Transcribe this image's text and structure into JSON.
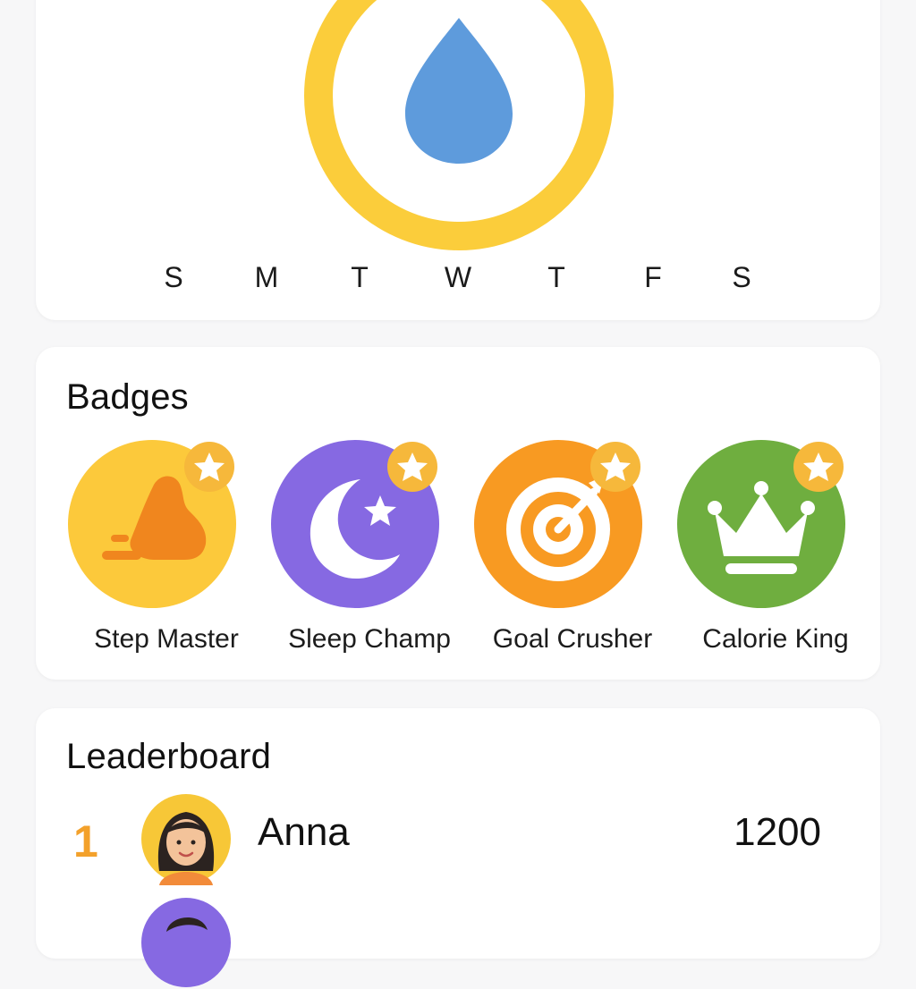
{
  "tracker": {
    "icon": "water-drop-icon",
    "ring_color": "#fbcd3b",
    "drop_color": "#5e9bdc",
    "days": [
      "S",
      "M",
      "T",
      "W",
      "T",
      "F",
      "S"
    ]
  },
  "badges": {
    "title": "Badges",
    "items": [
      {
        "label": "Step Master",
        "icon": "shoe-icon",
        "color": "#fcc93b",
        "icon_color": "#f0861e"
      },
      {
        "label": "Sleep Champ",
        "icon": "moon-star-icon",
        "color": "#8669e2",
        "icon_color": "#ffffff"
      },
      {
        "label": "Goal Crusher",
        "icon": "target-icon",
        "color": "#f89a22",
        "icon_color": "#ffffff"
      },
      {
        "label": "Calorie King",
        "icon": "crown-icon",
        "color": "#6fae3f",
        "icon_color": "#ffffff"
      }
    ],
    "star_badge_color": "#f6b83b"
  },
  "leaderboard": {
    "title": "Leaderboard",
    "rows": [
      {
        "rank": "1",
        "name": "Anna",
        "score": "1200",
        "avatar_color": "#f7c737"
      },
      {
        "rank": "",
        "name": "",
        "score": "",
        "avatar_color": "#8669e2"
      }
    ],
    "rank_color": "#f3a12b"
  }
}
